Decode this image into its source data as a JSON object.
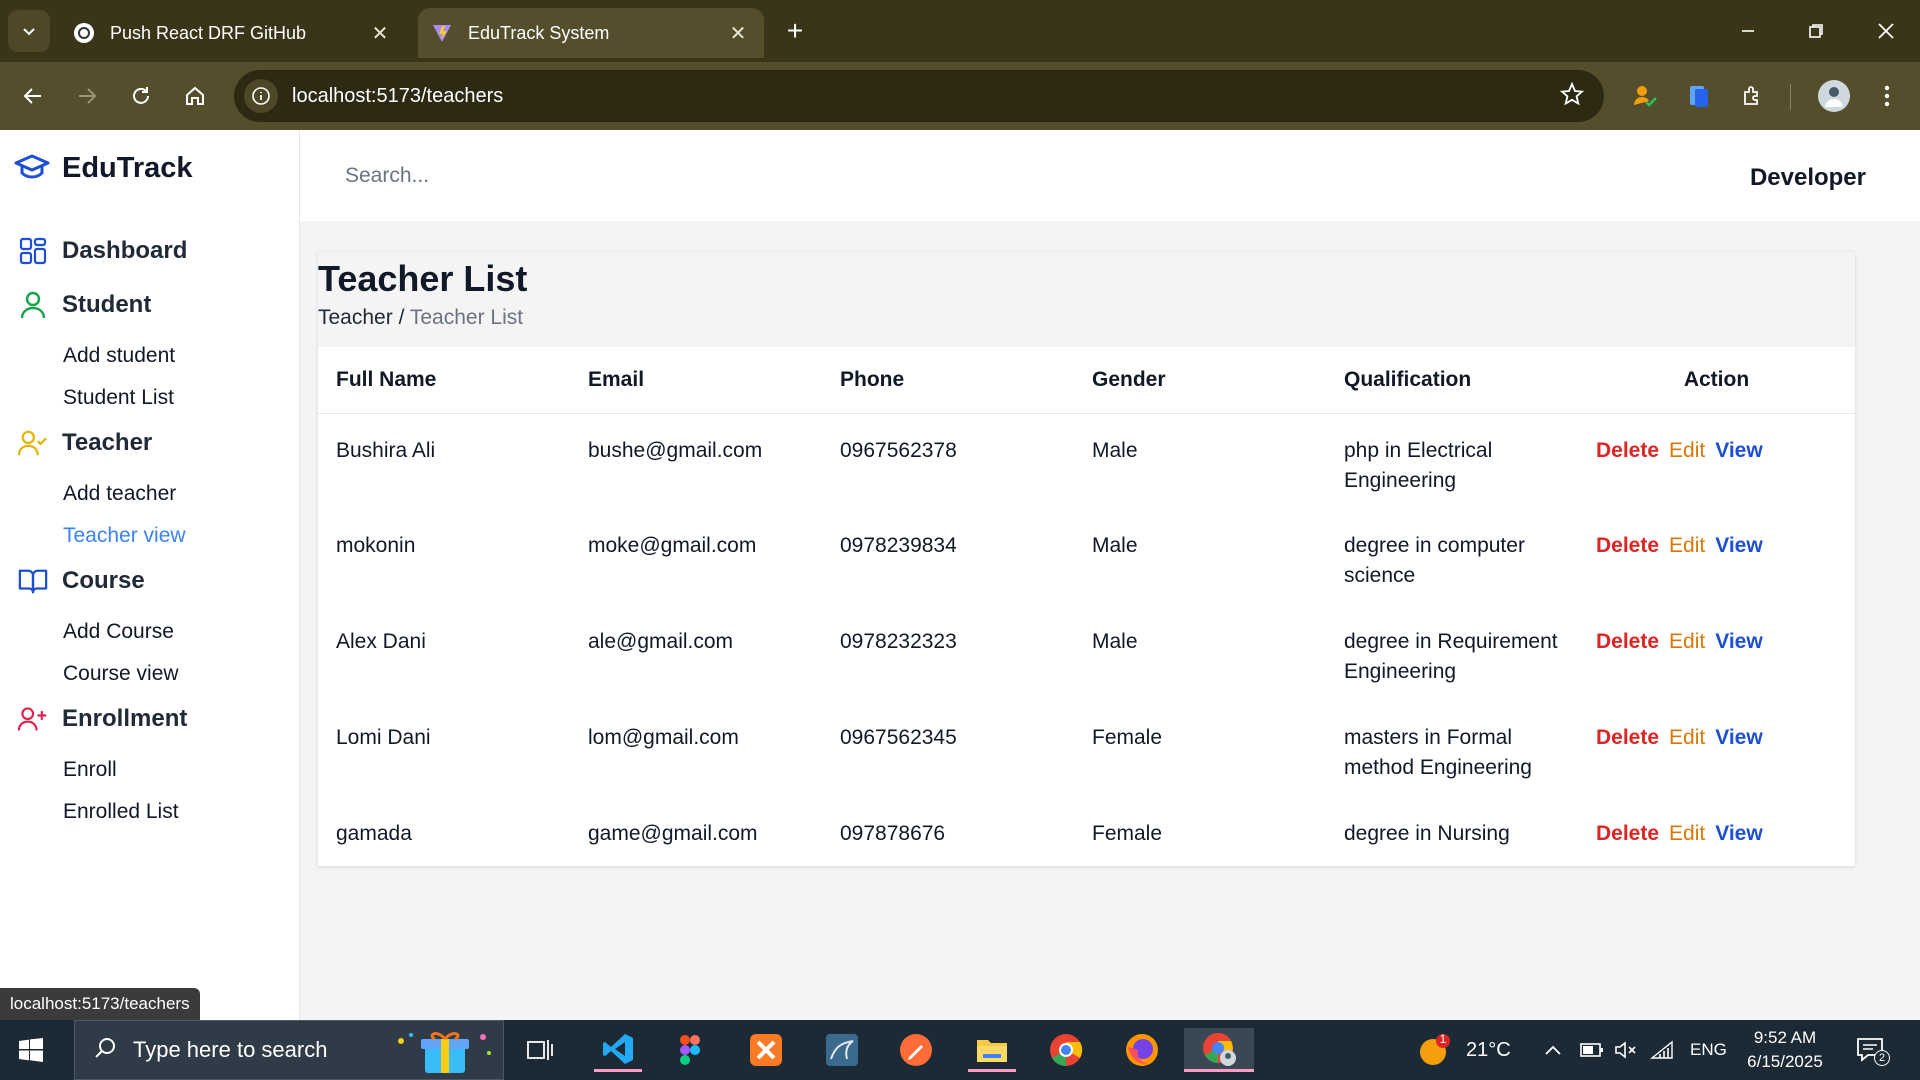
{
  "browser": {
    "tabs": [
      {
        "title": "Push React DRF GitHub",
        "active": false
      },
      {
        "title": "EduTrack System",
        "active": true
      }
    ],
    "url": "localhost:5173/teachers",
    "status_url": "localhost:5173/teachers"
  },
  "sidebar": {
    "brand": "EduTrack",
    "groups": [
      {
        "label": "Dashboard",
        "icon": "dashboard-grid-icon",
        "items": []
      },
      {
        "label": "Student",
        "icon": "user-icon",
        "items": [
          "Add student",
          "Student List"
        ]
      },
      {
        "label": "Teacher",
        "icon": "user-check-icon",
        "items": [
          "Add teacher",
          "Teacher view"
        ]
      },
      {
        "label": "Course",
        "icon": "book-open-icon",
        "items": [
          "Add Course",
          "Course view"
        ]
      },
      {
        "label": "Enrollment",
        "icon": "user-plus-icon",
        "items": [
          "Enroll",
          "Enrolled List"
        ]
      }
    ],
    "active_item": "Teacher view"
  },
  "topbar": {
    "search_placeholder": "Search...",
    "user": "Developer"
  },
  "page": {
    "title": "Teacher List",
    "breadcrumb": {
      "parent": "Teacher",
      "separator": "/",
      "current": "Teacher List"
    }
  },
  "table": {
    "columns": [
      "Full Name",
      "Email",
      "Phone",
      "Gender",
      "Qualification",
      "Action"
    ],
    "rows": [
      {
        "name": "Bushira Ali",
        "email": "bushe@gmail.com",
        "phone": "0967562378",
        "gender": "Male",
        "qualification": "php in Electrical Engineering"
      },
      {
        "name": "mokonin",
        "email": "moke@gmail.com",
        "phone": "0978239834",
        "gender": "Male",
        "qualification": "degree in computer science"
      },
      {
        "name": "Alex Dani",
        "email": "ale@gmail.com",
        "phone": "0978232323",
        "gender": "Male",
        "qualification": "degree in Requirement Engineering"
      },
      {
        "name": "Lomi Dani",
        "email": "lom@gmail.com",
        "phone": "0967562345",
        "gender": "Female",
        "qualification": "masters in Formal method Engineering"
      },
      {
        "name": "gamada",
        "email": "game@gmail.com",
        "phone": "097878676",
        "gender": "Female",
        "qualification": "degree in Nursing"
      }
    ],
    "actions": {
      "delete": "Delete",
      "edit": "Edit",
      "view": "View"
    }
  },
  "taskbar": {
    "search_placeholder": "Type here to search",
    "weather": "21°C",
    "weather_badge": "1",
    "language": "ENG",
    "time": "9:52 AM",
    "date": "6/15/2025",
    "notifications": "2"
  },
  "colors": {
    "accent": "#1d4ed8",
    "active_link": "#3b82f6",
    "delete": "#dc2626",
    "edit": "#d97706",
    "view": "#1d4ed8",
    "student_icon": "#16a34a",
    "teacher_icon": "#eab308",
    "enroll_icon": "#e11d48"
  }
}
